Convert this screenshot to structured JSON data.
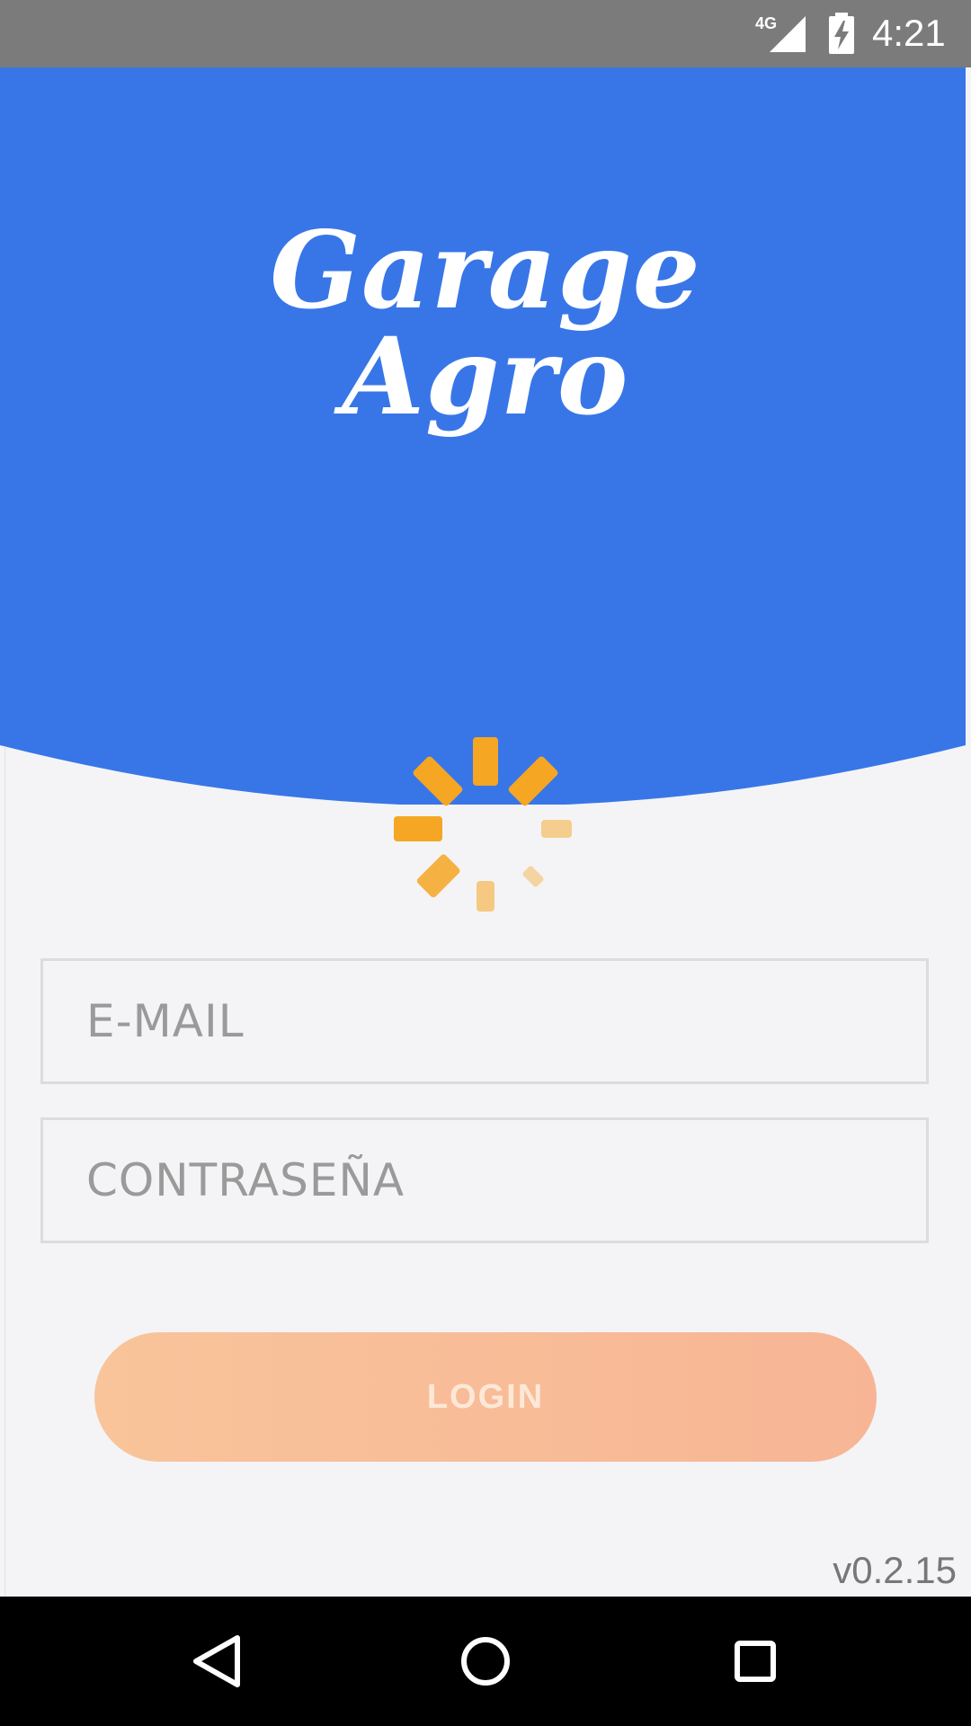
{
  "status_bar": {
    "network_label": "4G",
    "time": "4:21",
    "signal_icon": "cell-signal-icon",
    "battery_icon": "battery-charging-icon"
  },
  "header": {
    "logo_line1": "Garage",
    "logo_line2": "Agro",
    "background_color": "#3876e8"
  },
  "spinner": {
    "icon": "loading-spinner-icon",
    "color": "#f5a623"
  },
  "form": {
    "email_placeholder": "E-MAIL",
    "email_value": "",
    "password_placeholder": "CONTRASEÑA",
    "password_value": "",
    "login_label": "LOGIN"
  },
  "footer": {
    "version": "v0.2.15"
  },
  "nav_bar": {
    "back_icon": "back-triangle-icon",
    "home_icon": "home-circle-icon",
    "recent_icon": "recent-apps-square-icon"
  }
}
